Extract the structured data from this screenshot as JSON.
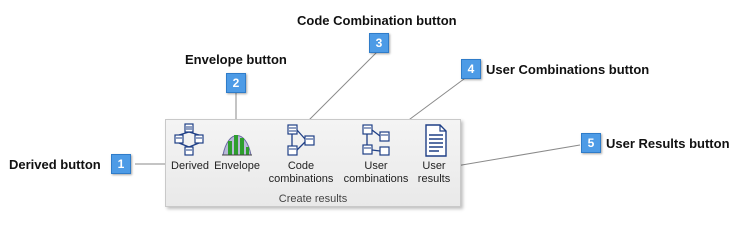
{
  "callouts": {
    "derived": {
      "label": "Derived button",
      "number": "1"
    },
    "envelope": {
      "label": "Envelope button",
      "number": "2"
    },
    "code_combination": {
      "label": "Code Combination button",
      "number": "3"
    },
    "user_combinations": {
      "label": "User Combinations button",
      "number": "4"
    },
    "user_results": {
      "label": "User Results button",
      "number": "5"
    }
  },
  "ribbon": {
    "group_label": "Create results",
    "buttons": {
      "derived": {
        "line1": "Derived",
        "line2": ""
      },
      "envelope": {
        "line1": "Envelope",
        "line2": ""
      },
      "code_combinations": {
        "line1": "Code",
        "line2": "combinations"
      },
      "user_combinations": {
        "line1": "User",
        "line2": "combinations"
      },
      "user_results": {
        "line1": "User",
        "line2": "results"
      }
    }
  },
  "colors": {
    "badge": "#4d9be6",
    "icon_blue": "#1f3f86",
    "icon_green": "#2e9e2e"
  }
}
